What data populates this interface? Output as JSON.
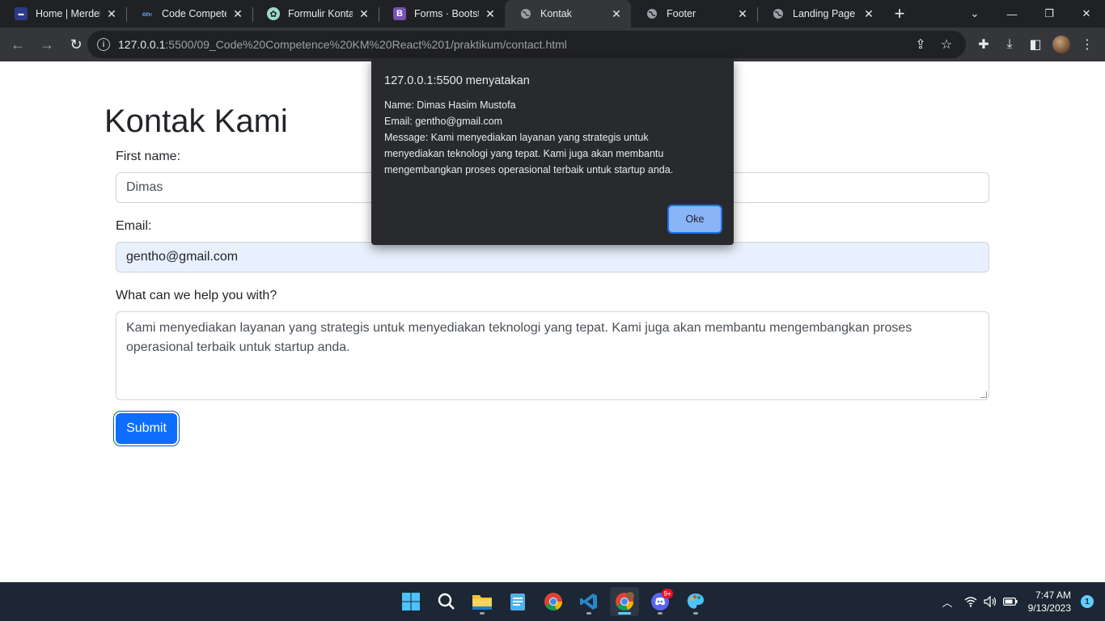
{
  "browser": {
    "tabs": [
      {
        "title": "Home | Merdeka",
        "icon": "merdeka-favicon",
        "active": false
      },
      {
        "title": "Code Competence",
        "icon": "alterra-favicon",
        "active": false
      },
      {
        "title": "Formulir Kontak Fo",
        "icon": "chatgpt-favicon",
        "active": false
      },
      {
        "title": "Forms · Bootstrap",
        "icon": "bootstrap-favicon",
        "active": false
      },
      {
        "title": "Kontak",
        "icon": "globe-icon",
        "active": true
      },
      {
        "title": "Footer",
        "icon": "globe-icon",
        "active": false
      },
      {
        "title": "Landing Page",
        "icon": "globe-icon",
        "active": false
      }
    ],
    "address": {
      "host": "127.0.0.1",
      "path": ":5500/09_Code%20Competence%20KM%20React%201/praktikum/contact.html"
    }
  },
  "page": {
    "heading": "Kontak Kami",
    "first_name_label": "First name:",
    "first_name_value": "Dimas",
    "email_label": "Email:",
    "email_value": "gentho@gmail.com",
    "message_label": "What can we help you with?",
    "message_value": "Kami menyediakan layanan yang strategis untuk menyediakan teknologi yang tepat. Kami juga akan membantu mengembangkan proses operasional terbaik untuk startup anda.",
    "submit_label": "Submit"
  },
  "dialog": {
    "title": "127.0.0.1:5500 menyatakan",
    "line_name": "Name: Dimas Hasim Mustofa",
    "line_email": "Email: gentho@gmail.com",
    "line_message": "Message: Kami menyediakan layanan yang strategis untuk menyediakan teknologi yang tepat. Kami juga akan membantu mengembangkan proses operasional terbaik untuk startup anda.",
    "ok_label": "Oke"
  },
  "taskbar": {
    "apps": [
      "start",
      "search",
      "file-explorer",
      "notepad",
      "chrome",
      "vscode",
      "chrome-profile",
      "discord",
      "paint"
    ],
    "discord_badge": "9+",
    "time": "7:47 AM",
    "date": "9/13/2023",
    "notifications": "1"
  },
  "colors": {
    "primary": "#0d6efd",
    "dialog_bg": "#292a2d",
    "dialog_button": "#8ab4f8",
    "autofill_bg": "#e8f0fe",
    "taskbar_bg": "#1c2634"
  }
}
